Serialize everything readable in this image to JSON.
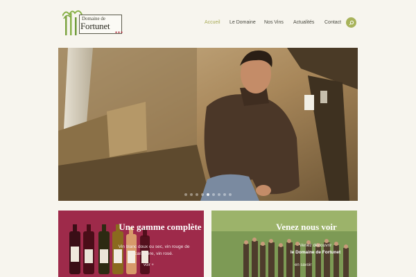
{
  "logo": {
    "line1": "Domaine de",
    "line2": "Fortunet"
  },
  "nav": {
    "items": [
      "Accueil",
      "Le Domaine",
      "Nos Vins",
      "Actualités",
      "Contact"
    ],
    "active": "Accueil"
  },
  "colors": {
    "accent": "#a8b35a",
    "wine_card": "#9e2a4a",
    "visit_card": "#6a8a4a",
    "background": "#f7f5ee"
  },
  "icons": {
    "search": "search-icon"
  },
  "cards": {
    "wine": {
      "title": "Une gamme complète",
      "text": "Vin blanc doux ou sec, vin rouge de caractère, vin rosé.",
      "more": "voir +"
    },
    "visit": {
      "title": "Venez nous voir",
      "text": "Venez découvrir",
      "highlight": "le Domaine de Fortunet",
      "more": "en savoir"
    }
  }
}
